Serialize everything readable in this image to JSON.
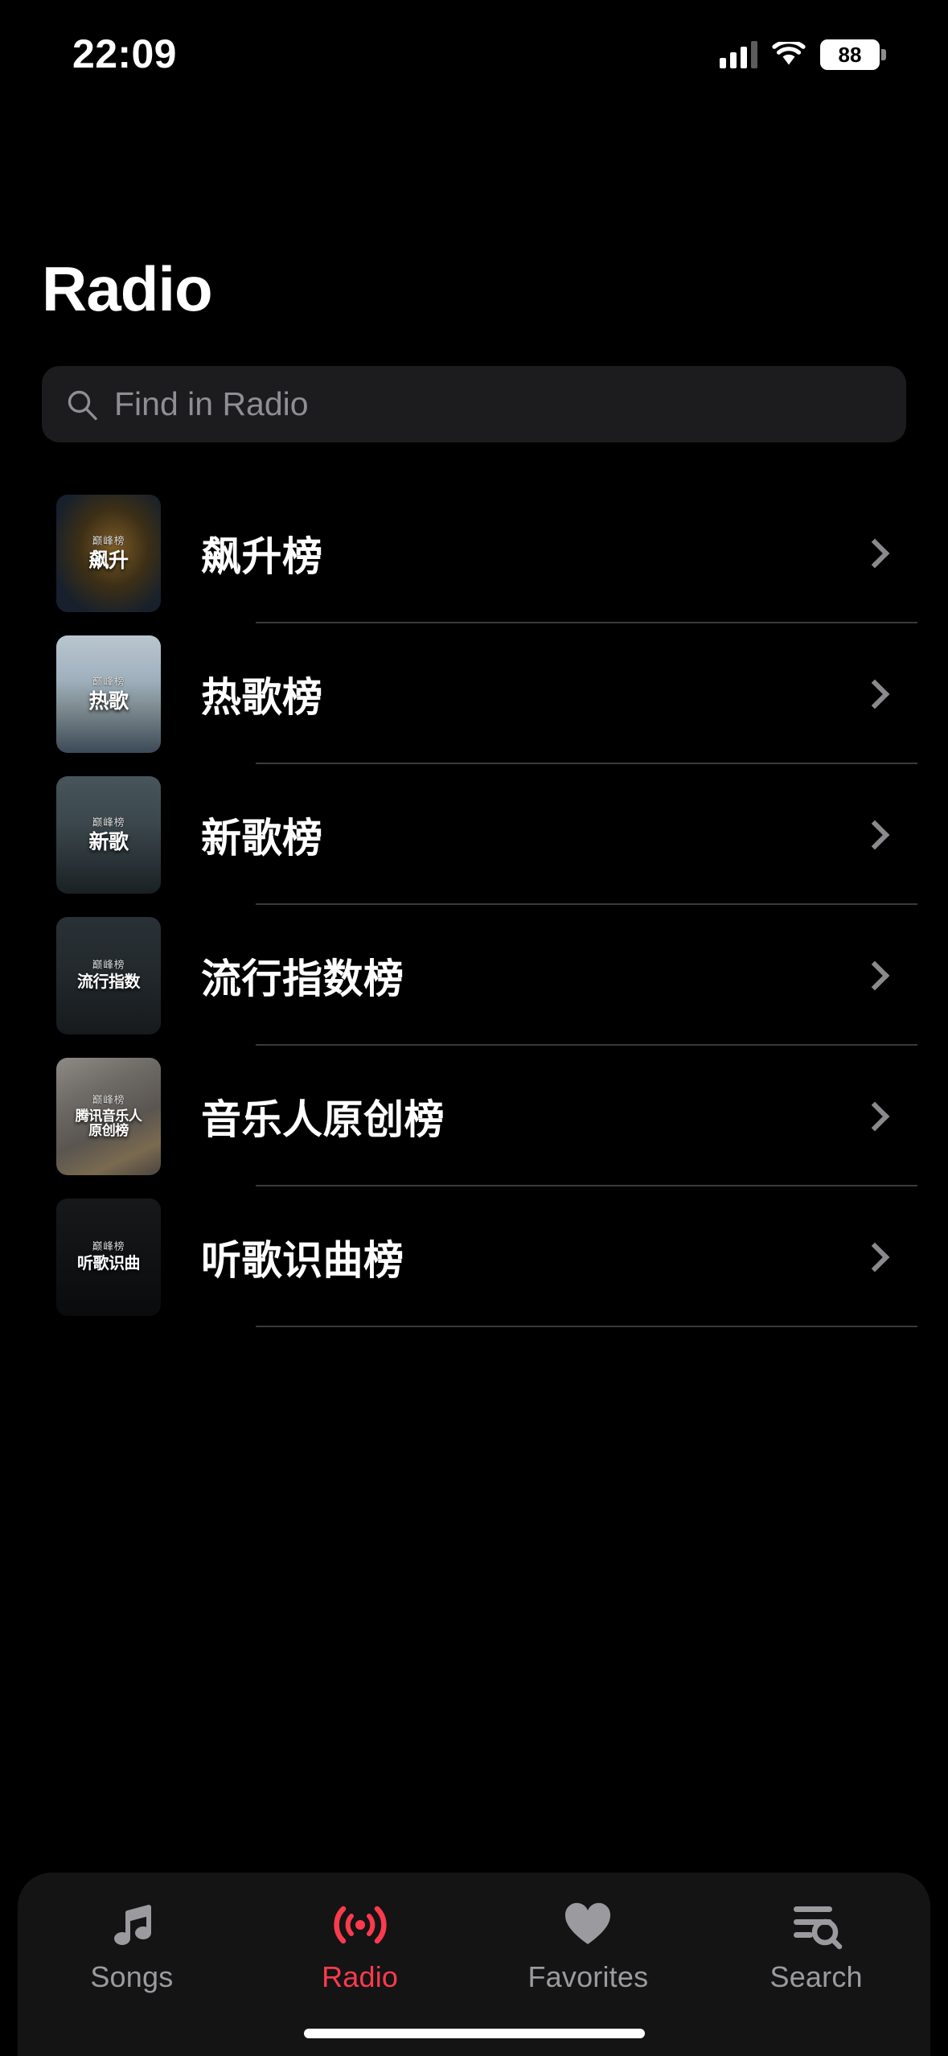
{
  "status_bar": {
    "time": "22:09",
    "battery_percent": "88",
    "cellular_icon": "cellular-signal-icon",
    "wifi_icon": "wifi-icon",
    "battery_icon": "battery-icon"
  },
  "header": {
    "title": "Radio"
  },
  "search": {
    "placeholder": "Find in Radio",
    "value": "",
    "icon": "search-icon"
  },
  "list": {
    "chevron_icon": "chevron-right-icon",
    "items": [
      {
        "title": "飙升榜",
        "thumb_badge": "巅峰榜",
        "thumb_name": "飙升",
        "art": "art1",
        "name_size": ""
      },
      {
        "title": "热歌榜",
        "thumb_badge": "巅峰榜",
        "thumb_name": "热歌",
        "art": "art2",
        "name_size": ""
      },
      {
        "title": "新歌榜",
        "thumb_badge": "巅峰榜",
        "thumb_name": "新歌",
        "art": "art3",
        "name_size": ""
      },
      {
        "title": "流行指数榜",
        "thumb_badge": "巅峰榜",
        "thumb_name": "流行指数",
        "art": "art4",
        "name_size": "small"
      },
      {
        "title": "音乐人原创榜",
        "thumb_badge": "巅峰榜",
        "thumb_name": "腾讯音乐人\n原创榜",
        "art": "art5",
        "name_size": "xsmall"
      },
      {
        "title": "听歌识曲榜",
        "thumb_badge": "巅峰榜",
        "thumb_name": "听歌识曲",
        "art": "art6",
        "name_size": "small"
      }
    ]
  },
  "tabbar": {
    "active_color": "#fb3b4d",
    "inactive_color": "#9b9b9f",
    "tabs": [
      {
        "label": "Songs",
        "icon": "music-note-icon",
        "active": false
      },
      {
        "label": "Radio",
        "icon": "broadcast-icon",
        "active": true
      },
      {
        "label": "Favorites",
        "icon": "heart-icon",
        "active": false
      },
      {
        "label": "Search",
        "icon": "list-search-icon",
        "active": false
      }
    ]
  }
}
